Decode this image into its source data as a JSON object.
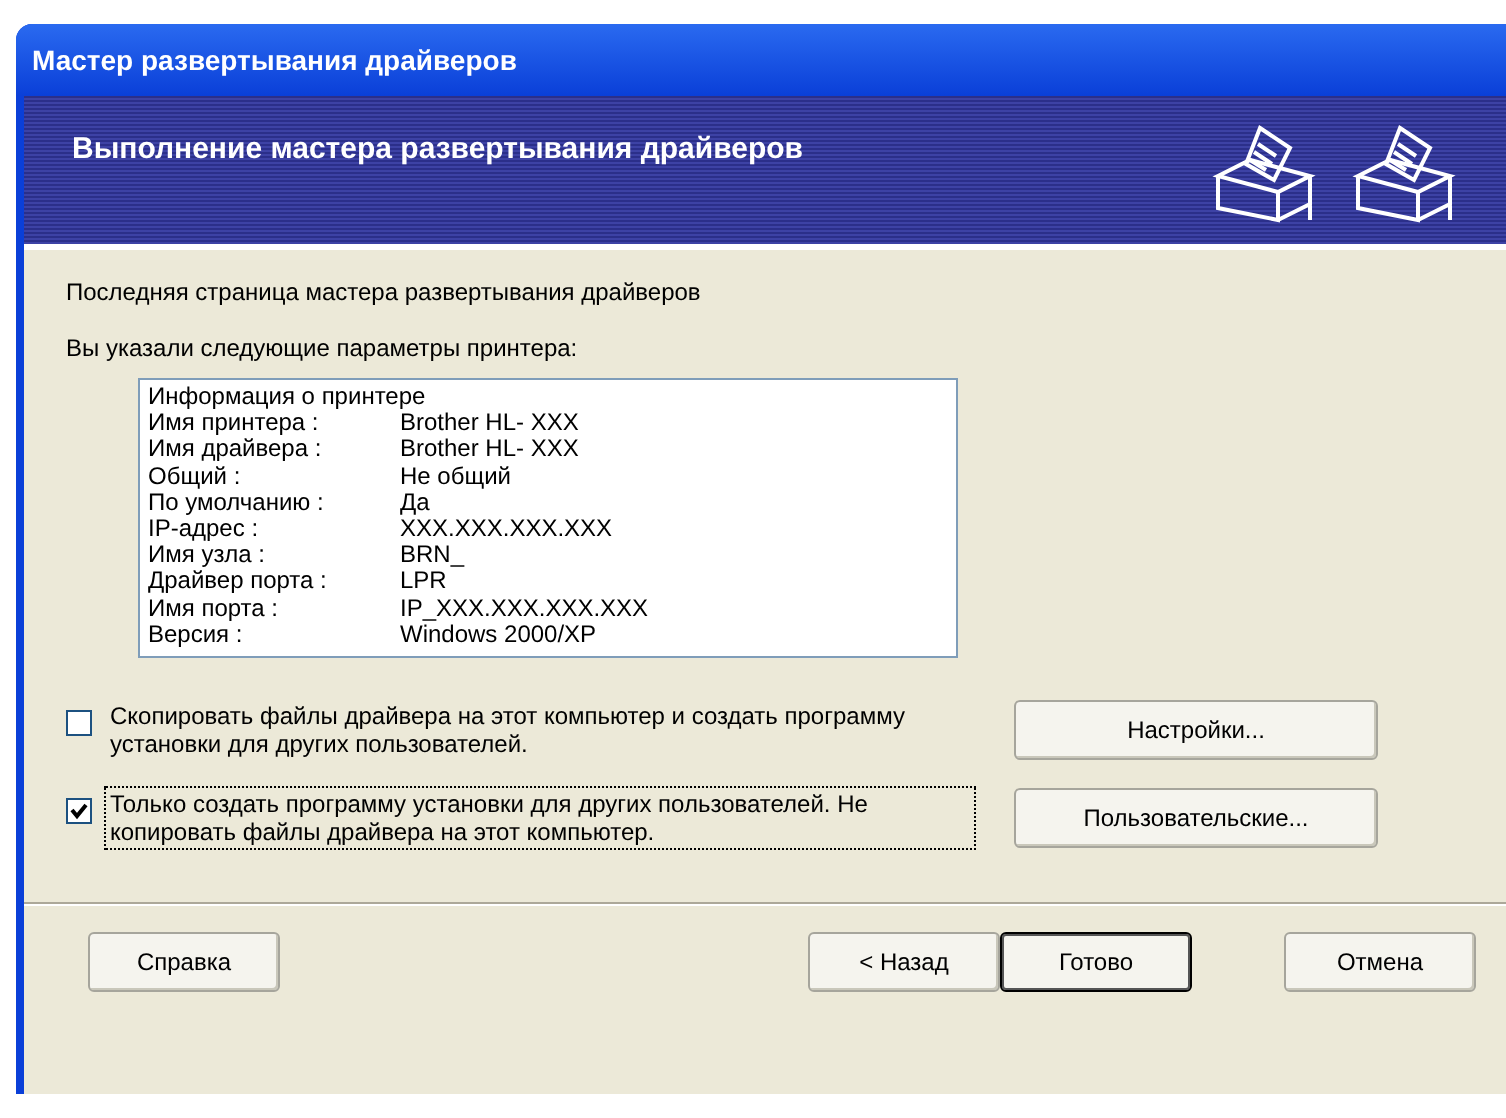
{
  "window": {
    "title": "Мастер развертывания драйверов"
  },
  "header": {
    "title": "Выполнение мастера развертывания драйверов"
  },
  "intro": "Последняя страница мастера развертывания драйверов",
  "summary_label": "Вы указали следующие параметры принтера:",
  "summary": {
    "heading": "Информация о принтере",
    "rows": [
      {
        "label": "Имя принтера :",
        "value": "Brother HL- XXX"
      },
      {
        "label": "Имя драйвера :",
        "value": "Brother HL- XXX"
      },
      {
        "label": "Общий :",
        "value": "Не общий"
      },
      {
        "label": "По умолчанию :",
        "value": "Да"
      },
      {
        "label": "IP-адрес :",
        "value": "XXX.XXX.XXX.XXX"
      },
      {
        "label": "Имя узла :",
        "value": "BRN_"
      },
      {
        "label": "Драйвер порта :",
        "value": "LPR"
      },
      {
        "label": "Имя порта :",
        "value": "IP_XXX.XXX.XXX.XXX"
      },
      {
        "label": "Версия :",
        "value": "Windows 2000/XP"
      }
    ]
  },
  "options": [
    {
      "label": "Скопировать файлы драйвера на этот компьютер и создать программу установки для других пользователей.",
      "checked": false,
      "focused": false,
      "button": "Настройки..."
    },
    {
      "label": "Только создать программу установки для других пользователей. Не копировать файлы драйвера на этот компьютер.",
      "checked": true,
      "focused": true,
      "button": "Пользовательские..."
    }
  ],
  "buttons": [
    {
      "label": "Справка",
      "kind": "help",
      "default": false
    },
    {
      "label": "< Назад",
      "kind": "nav",
      "default": false
    },
    {
      "label": "Готово",
      "kind": "nav",
      "default": true
    },
    {
      "label": "Отмена",
      "kind": "cancel",
      "default": false
    }
  ]
}
